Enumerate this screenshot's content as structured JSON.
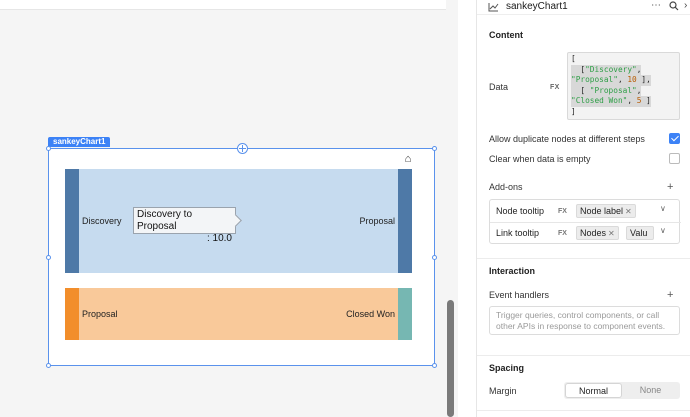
{
  "component": {
    "tag": "sankeyChart1"
  },
  "chart_data": {
    "type": "sankey",
    "nodes": [
      "Discovery",
      "Proposal",
      "Closed Won"
    ],
    "links": [
      {
        "source": "Discovery",
        "target": "Proposal",
        "value": 10
      },
      {
        "source": "Proposal",
        "target": "Closed Won",
        "value": 5
      }
    ],
    "node_labels": {
      "left_top": "Discovery",
      "right_top": "Proposal",
      "left_bottom": "Proposal",
      "right_bottom": "Closed Won"
    },
    "tooltip": {
      "line1": "Discovery to Proposal",
      "line2": ": 10.0"
    },
    "colors": {
      "discovery": "#4e79a7",
      "proposal_right": "#4e79a7",
      "proposal_left": "#f28e2b",
      "closed_won": "#76b7b2",
      "link_top": "#c6dbef",
      "link_bottom": "#f9c99a"
    }
  },
  "panel": {
    "title": "sankeyChart1",
    "more_icon": "more-horizontal-icon",
    "search_icon": "search-icon",
    "collapse_icon": "chevron-right-icon",
    "content": {
      "heading": "Content",
      "data_label": "Data",
      "fx": "FX",
      "data_code": {
        "l1": "[",
        "l2a": "  [",
        "l2b": "\"Discovery\"",
        "l2c": ",",
        "l3a": "\"Proposal\"",
        "l3b": ", ",
        "l3c": "10",
        "l3d": " ],",
        "l4a": "  [ ",
        "l4b": "\"Proposal\"",
        "l4c": ",",
        "l5a": "\"Closed Won\"",
        "l5b": ", ",
        "l5c": "5",
        "l5d": " ]",
        "l6": "]"
      },
      "allow_duplicate_label": "Allow duplicate nodes at different steps",
      "allow_duplicate_checked": true,
      "clear_when_empty_label": "Clear when data is empty",
      "clear_when_empty_checked": false,
      "addons_label": "Add-ons",
      "addons": [
        {
          "name": "Node tooltip",
          "fx": "FX",
          "tags": [
            "Node label"
          ]
        },
        {
          "name": "Link tooltip",
          "fx": "FX",
          "tags": [
            "Nodes",
            "Valu"
          ]
        }
      ]
    },
    "interaction": {
      "heading": "Interaction",
      "event_handlers_label": "Event handlers",
      "event_handlers_hint": "Trigger queries, control components, or call other APIs in response to component events."
    },
    "spacing": {
      "heading": "Spacing",
      "margin_label": "Margin",
      "options": [
        "Normal",
        "None"
      ],
      "selected": "Normal"
    }
  }
}
